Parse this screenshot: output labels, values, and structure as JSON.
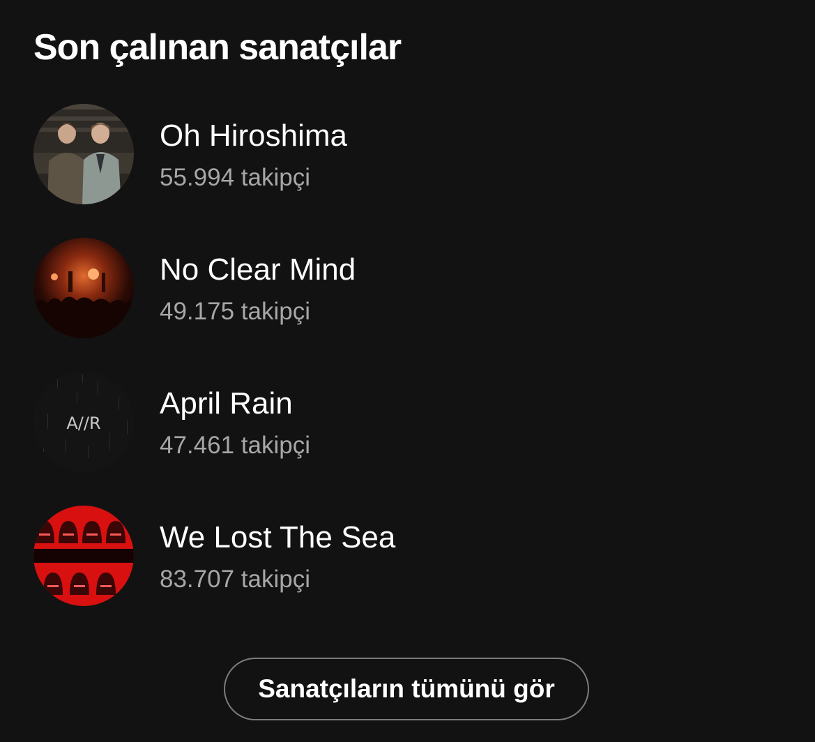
{
  "section": {
    "title": "Son çalınan sanatçılar"
  },
  "artists": [
    {
      "name": "Oh Hiroshima",
      "followers": "55.994 takipçi",
      "avatar": "band-photo-two-men"
    },
    {
      "name": "No Clear Mind",
      "followers": "49.175 takipçi",
      "avatar": "concert-stage-red-lights"
    },
    {
      "name": "April Rain",
      "followers": "47.461 takipçi",
      "avatar": "dark-logo",
      "avatar_text": "A//R"
    },
    {
      "name": "We Lost The Sea",
      "followers": "83.707 takipçi",
      "avatar": "red-hooded-figures"
    }
  ],
  "actions": {
    "see_all_label": "Sanatçıların tümünü gör"
  },
  "colors": {
    "background": "#121212",
    "text_primary": "#ffffff",
    "text_secondary": "#a7a7a7",
    "button_border": "#7c7c7c",
    "accent_red": "#e01010"
  }
}
